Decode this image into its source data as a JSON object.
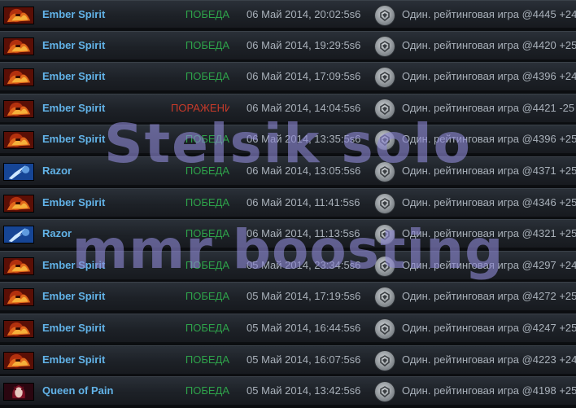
{
  "matches": [
    {
      "hero": "Ember Spirit",
      "hero_icon": "ember-spirit-portrait",
      "result": "ПОБЕДА",
      "outcome": "win",
      "date": "06 Май 2014, 20:02:5s6",
      "mode": "Один. рейтинговая игра @4445 +24"
    },
    {
      "hero": "Ember Spirit",
      "hero_icon": "ember-spirit-portrait",
      "result": "ПОБЕДА",
      "outcome": "win",
      "date": "06 Май 2014, 19:29:5s6",
      "mode": "Один. рейтинговая игра @4420 +25"
    },
    {
      "hero": "Ember Spirit",
      "hero_icon": "ember-spirit-portrait",
      "result": "ПОБЕДА",
      "outcome": "win",
      "date": "06 Май 2014, 17:09:5s6",
      "mode": "Один. рейтинговая игра @4396 +24"
    },
    {
      "hero": "Ember Spirit",
      "hero_icon": "ember-spirit-portrait",
      "result": "ПОРАЖЕНИ",
      "outcome": "loss",
      "date": "06 Май 2014, 14:04:5s6",
      "mode": "Один. рейтинговая игра @4421 -25"
    },
    {
      "hero": "Ember Spirit",
      "hero_icon": "ember-spirit-portrait",
      "result": "ПОБЕДА",
      "outcome": "win",
      "date": "06 Май 2014, 13:35:5s6",
      "mode": "Один. рейтинговая игра @4396 +25"
    },
    {
      "hero": "Razor",
      "hero_icon": "razor-portrait",
      "result": "ПОБЕДА",
      "outcome": "win",
      "date": "06 Май 2014, 13:05:5s6",
      "mode": "Один. рейтинговая игра @4371 +25"
    },
    {
      "hero": "Ember Spirit",
      "hero_icon": "ember-spirit-portrait",
      "result": "ПОБЕДА",
      "outcome": "win",
      "date": "06 Май 2014, 11:41:5s6",
      "mode": "Один. рейтинговая игра @4346 +25"
    },
    {
      "hero": "Razor",
      "hero_icon": "razor-portrait",
      "result": "ПОБЕДА",
      "outcome": "win",
      "date": "06 Май 2014, 11:13:5s6",
      "mode": "Один. рейтинговая игра @4321 +25"
    },
    {
      "hero": "Ember Spirit",
      "hero_icon": "ember-spirit-portrait",
      "result": "ПОБЕДА",
      "outcome": "win",
      "date": "05 Май 2014, 23:34:5s6",
      "mode": "Один. рейтинговая игра @4297 +24"
    },
    {
      "hero": "Ember Spirit",
      "hero_icon": "ember-spirit-portrait",
      "result": "ПОБЕДА",
      "outcome": "win",
      "date": "05 Май 2014, 17:19:5s6",
      "mode": "Один. рейтинговая игра @4272 +25"
    },
    {
      "hero": "Ember Spirit",
      "hero_icon": "ember-spirit-portrait",
      "result": "ПОБЕДА",
      "outcome": "win",
      "date": "05 Май 2014, 16:44:5s6",
      "mode": "Один. рейтинговая игра @4247 +25"
    },
    {
      "hero": "Ember Spirit",
      "hero_icon": "ember-spirit-portrait",
      "result": "ПОБЕДА",
      "outcome": "win",
      "date": "05 Май 2014, 16:07:5s6",
      "mode": "Один. рейтинговая игра @4223 +24"
    },
    {
      "hero": "Queen of Pain",
      "hero_icon": "queen-of-pain-portrait",
      "result": "ПОБЕДА",
      "outcome": "win",
      "date": "05 Май 2014, 13:42:5s6",
      "mode": "Один. рейтинговая игра @4198 +25"
    }
  ],
  "mode_icon": "ranked-matchmaking-icon",
  "watermark": {
    "line1": "Stelsik solo",
    "line2": "mmr boosting"
  },
  "colors": {
    "win": "#2ea24a",
    "loss": "#c83a2a",
    "hero": "#62b3e8",
    "text": "#a9b1ba"
  }
}
